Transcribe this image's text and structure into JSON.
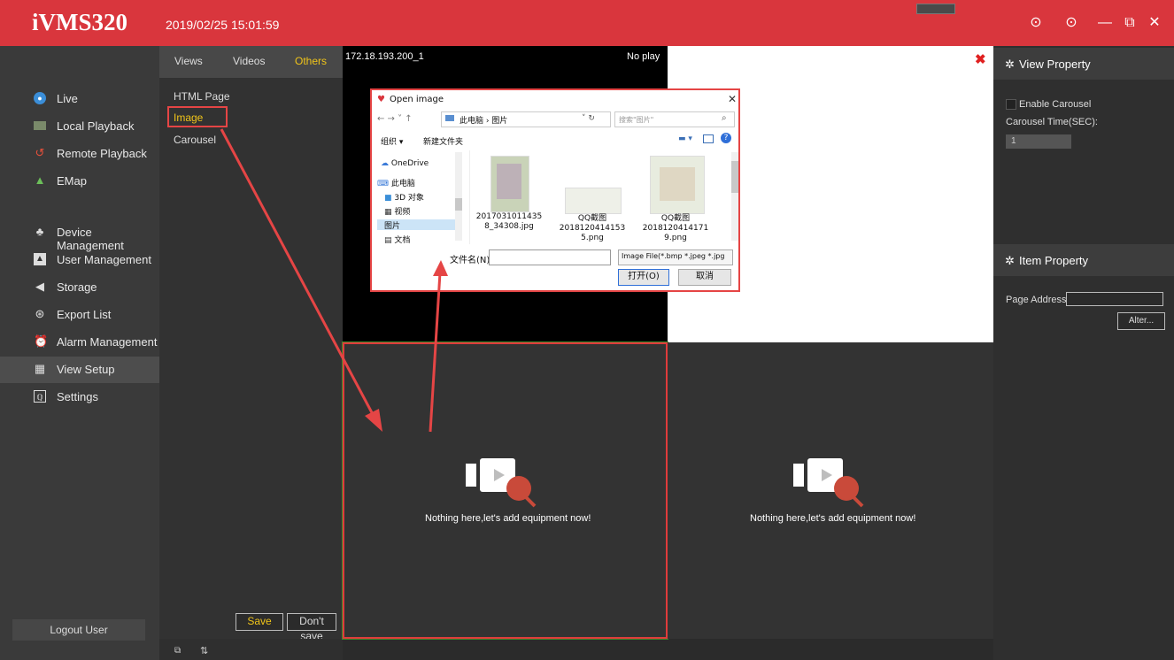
{
  "app": {
    "title": "iVMS320",
    "datetime": "2019/02/25 15:01:59"
  },
  "window_controls": {
    "info_icon": "⊙",
    "help_icon": "⊙",
    "minimize": "—",
    "restore": "⧉",
    "close": "✕"
  },
  "sidebar": {
    "items": [
      {
        "label": "Live",
        "icon": "live-icon"
      },
      {
        "label": "Local Playback",
        "icon": "local-playback-icon"
      },
      {
        "label": "Remote Playback",
        "icon": "remote-playback-icon"
      },
      {
        "label": "EMap",
        "icon": "emap-icon"
      },
      {
        "label": "Device Management",
        "icon": "device-icon"
      },
      {
        "label": "User Management",
        "icon": "user-icon"
      },
      {
        "label": "Storage",
        "icon": "storage-icon"
      },
      {
        "label": "Export List",
        "icon": "export-icon"
      },
      {
        "label": "Alarm Management",
        "icon": "alarm-icon"
      },
      {
        "label": "View Setup",
        "icon": "view-setup-icon"
      },
      {
        "label": "Settings",
        "icon": "settings-icon"
      }
    ],
    "active": "View Setup",
    "logout_label": "Logout User"
  },
  "setup": {
    "tabs": [
      "Views",
      "Videos",
      "Others"
    ],
    "active_tab": "Others",
    "items": [
      "HTML Page",
      "Image",
      "Carousel"
    ],
    "active_item": "Image",
    "save_label": "Save",
    "dont_save_label": "Don't save"
  },
  "video": {
    "cell1_label": "172.18.193.200_1",
    "cell1_status": "No play",
    "empty_text": "Nothing here,let's add equipment now!"
  },
  "view_property": {
    "title": "View Property",
    "enable_carousel_label": "Enable Carousel",
    "carousel_time_label": "Carousel Time(SEC):",
    "carousel_time_value": "1"
  },
  "item_property": {
    "title": "Item Property",
    "page_address_label": "Page Address:",
    "page_address_value": "",
    "alter_label": "Alter..."
  },
  "dialog": {
    "title": "Open image",
    "breadcrumb": "此电脑 › 图片",
    "search_placeholder": "搜索\"图片\"",
    "organize_label": "组织 ▾",
    "new_folder_label": "新建文件夹",
    "tree": [
      "OneDrive",
      "此电脑",
      "3D 对象",
      "视频",
      "图片",
      "文档"
    ],
    "files": [
      {
        "name_line1": "2017031011435",
        "name_line2": "8_34308.jpg"
      },
      {
        "name_line1": "QQ截图",
        "name_line2": "2018120414153",
        "name_line3": "5.png"
      },
      {
        "name_line1": "QQ截图",
        "name_line2": "2018120414171",
        "name_line3": "9.png"
      }
    ],
    "filename_label": "文件名(N):",
    "filename_value": "",
    "filetype_value": "Image File(*.bmp *.jpeg *.jpg",
    "open_label": "打开(O)",
    "cancel_label": "取消"
  },
  "colors": {
    "titlebar": "#d9363d",
    "accent": "#f0c419",
    "highlight": "#e54545"
  }
}
